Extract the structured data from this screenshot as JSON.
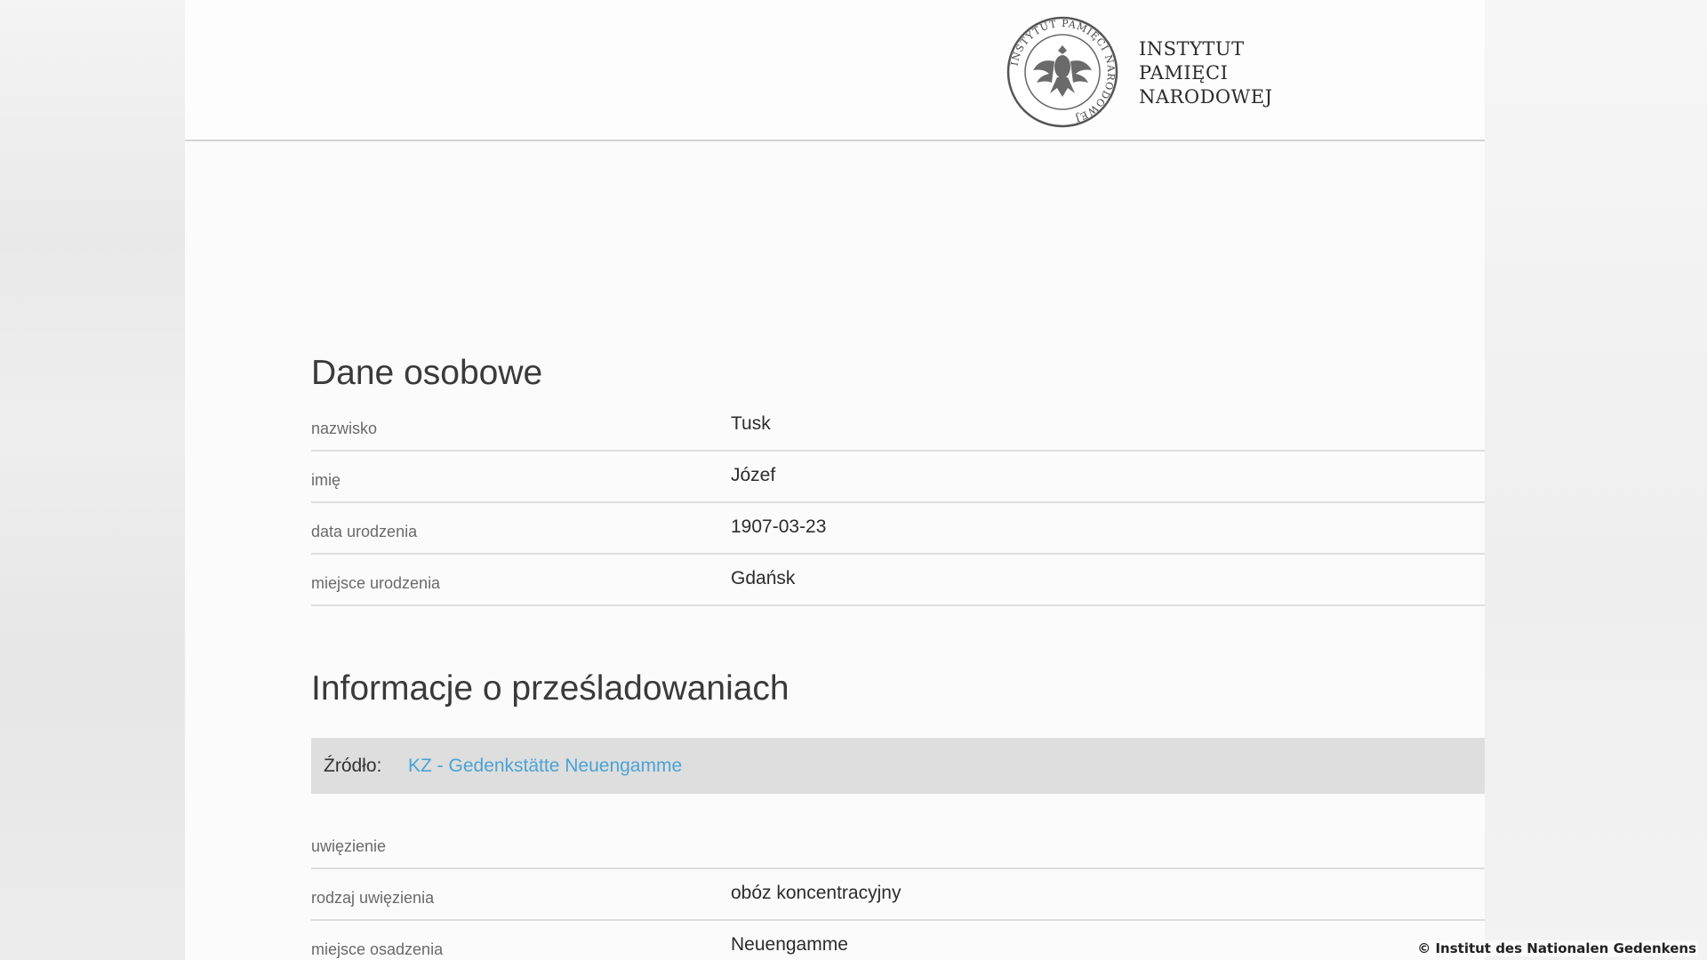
{
  "header": {
    "logo_lines": [
      "INSTYTUT",
      "PAMIĘCI",
      "NARODOWEJ"
    ],
    "seal_ring_text": "INSTYTUT PAMIĘCI NARODOWEJ"
  },
  "personal": {
    "title": "Dane osobowe",
    "rows": [
      {
        "label": "nazwisko",
        "value": "Tusk"
      },
      {
        "label": "imię",
        "value": "Józef"
      },
      {
        "label": "data urodzenia",
        "value": "1907-03-23"
      },
      {
        "label": "miejsce urodzenia",
        "value": "Gdańsk"
      }
    ]
  },
  "persecution": {
    "title": "Informacje o prześladowaniach",
    "source_label": "Źródło:",
    "source_link": "KZ - Gedenkstätte Neuengamme",
    "rows": [
      {
        "label": "uwięzienie",
        "value": ""
      },
      {
        "label": "rodzaj uwięzienia",
        "value": "obóz koncentracyjny"
      },
      {
        "label": "miejsce osadzenia",
        "value": "Neuengamme"
      }
    ]
  },
  "copyright": "© Institut des Nationalen Gedenkens"
}
